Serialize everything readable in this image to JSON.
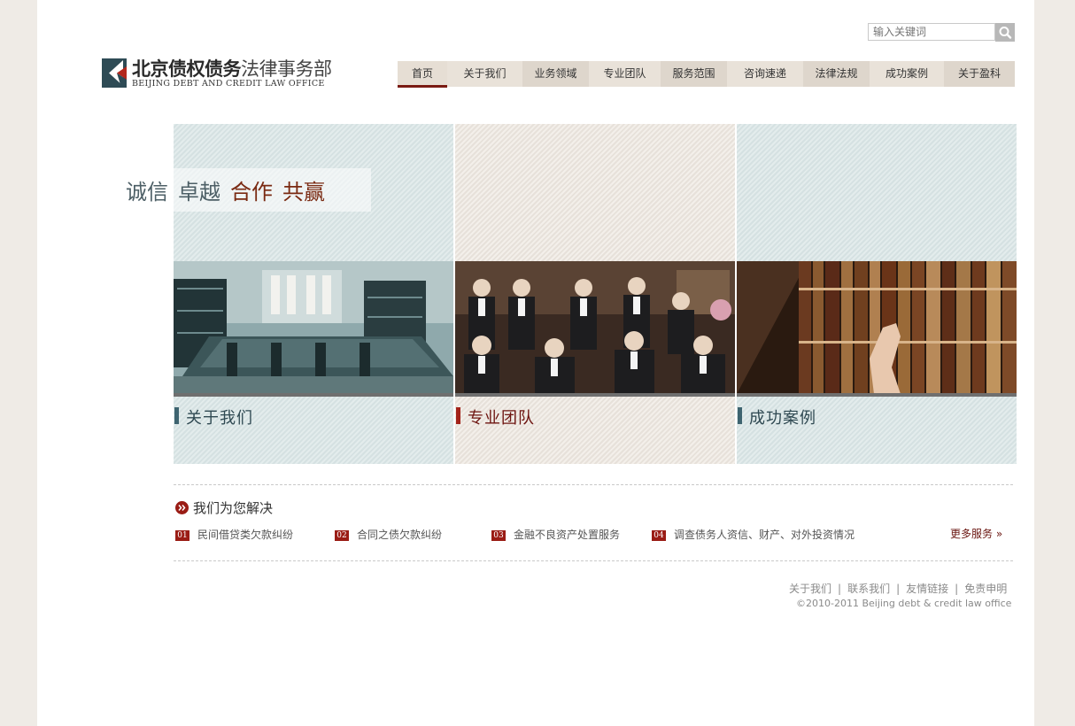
{
  "search": {
    "placeholder": "输入关键词"
  },
  "logo": {
    "title_bold": "北京债权债务",
    "title_light": "法律事务部",
    "subtitle": "BEIJING DEBT AND CREDIT LAW OFFICE"
  },
  "nav": {
    "items": [
      {
        "label": "首页",
        "active": true
      },
      {
        "label": "关于我们"
      },
      {
        "label": "业务领域"
      },
      {
        "label": "专业团队"
      },
      {
        "label": "服务范围"
      },
      {
        "label": "咨询速递"
      },
      {
        "label": "法律法规"
      },
      {
        "label": "成功案例"
      },
      {
        "label": "关于盈科"
      }
    ]
  },
  "slogan": {
    "words": [
      "诚信",
      "卓越",
      "合作",
      "共赢"
    ]
  },
  "panels": [
    {
      "label": "关于我们"
    },
    {
      "label": "专业团队"
    },
    {
      "label": "成功案例"
    }
  ],
  "services": {
    "title": "我们为您解决",
    "items": [
      {
        "num": "01",
        "label": "民间借贷类欠款纠纷"
      },
      {
        "num": "02",
        "label": "合同之债欠款纠纷"
      },
      {
        "num": "03",
        "label": "金融不良资产处置服务"
      },
      {
        "num": "04",
        "label": "调查债务人资信、财产、对外投资情况"
      }
    ],
    "more": "更多服务 »"
  },
  "footer": {
    "links": [
      "关于我们",
      "联系我们",
      "友情链接",
      "免责申明"
    ],
    "separator": "|",
    "copyright": "©2010-2011  Beijing debt & credit law office"
  },
  "colors": {
    "accent": "#7a1b13",
    "teal_text": "#2f4952",
    "slogan_gray": "#4d5f66",
    "slogan_red": "#7a2a12"
  }
}
